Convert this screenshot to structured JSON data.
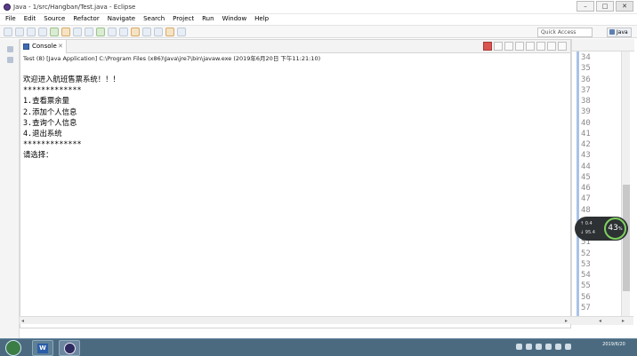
{
  "window": {
    "title": "Java - 1/src/Hangban/Test.java - Eclipse",
    "controls": [
      "–",
      "□",
      "✕"
    ]
  },
  "menu": [
    "File",
    "Edit",
    "Source",
    "Refactor",
    "Navigate",
    "Search",
    "Project",
    "Run",
    "Window",
    "Help"
  ],
  "toolbar": {
    "quick_access": "Quick Access",
    "perspective": "Java"
  },
  "console": {
    "tab_label": "Console",
    "tab_close": "✕",
    "launch_path": "Test (8) [Java Application] C:\\Program Files (x86)\\Java\\jre7\\bin\\javaw.exe (2019年6月20日 下午11:21:10)",
    "output": [
      "欢迎进入航班售票系统！！！",
      "*************",
      "1.查看票余量",
      "2.添加个人信息",
      "3.查询个人信息",
      "4.退出系统",
      "*************",
      "请选择："
    ]
  },
  "line_numbers": [
    "34",
    "35",
    "36",
    "37",
    "38",
    "39",
    "40",
    "41",
    "42",
    "43",
    "44",
    "45",
    "46",
    "47",
    "48",
    "49",
    "50",
    "51",
    "52",
    "53",
    "54",
    "55",
    "56",
    "57"
  ],
  "net_widget": {
    "upload": "↑ 0.4",
    "download": "↓ 95.4",
    "percent": "43",
    "percent_unit": "%"
  },
  "taskbar": {
    "word_label": "W",
    "clock_date": "2019/6/20"
  },
  "colors": {
    "accent": "#3e6cb3",
    "taskbar": "#4b6a80",
    "net_ring": "#7ed05e"
  }
}
